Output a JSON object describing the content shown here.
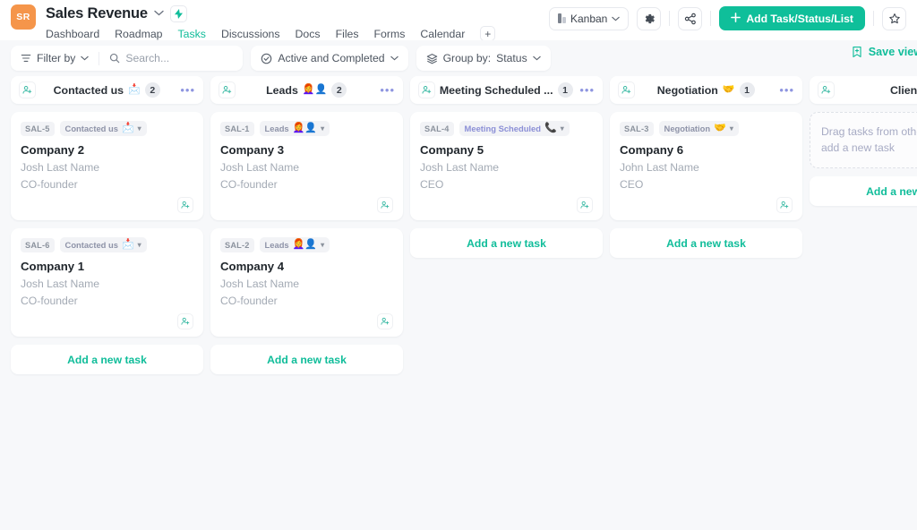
{
  "header": {
    "workspace_initials": "SR",
    "project_title": "Sales Revenue",
    "bolt_icon": "lightning-bolt-icon",
    "nav": [
      {
        "label": "Dashboard",
        "active": false
      },
      {
        "label": "Roadmap",
        "active": false
      },
      {
        "label": "Tasks",
        "active": true
      },
      {
        "label": "Discussions",
        "active": false
      },
      {
        "label": "Docs",
        "active": false
      },
      {
        "label": "Files",
        "active": false
      },
      {
        "label": "Forms",
        "active": false
      },
      {
        "label": "Calendar",
        "active": false
      }
    ],
    "add_tab_label": "+",
    "view_selector": "Kanban",
    "settings_icon": "gear-icon",
    "share_icon": "share-icon",
    "add_button": "Add Task/Status/List",
    "favorite_icon": "star-icon"
  },
  "toolbar": {
    "filter_label": "Filter by",
    "search_placeholder": "Search...",
    "status_filter": "Active and Completed",
    "group_by_label": "Group by:",
    "group_by_value": "Status",
    "save_view_label": "Save view"
  },
  "colors": {
    "accent": "#0fbf9a",
    "avatar_orange": "#f5954a",
    "status_contacted": "#8e93a8",
    "status_leads": "#8e93a8",
    "status_meeting": "#8b8fd6",
    "status_negotiation": "#8e93a8"
  },
  "board": {
    "columns": [
      {
        "title": "Contacted us",
        "emoji": "📩",
        "count": "2",
        "add_person_icon": "add-person-icon",
        "menu_icon": "more-options-icon",
        "add_task_label": "Add a new task",
        "cards": [
          {
            "id": "SAL-5",
            "status": "Contacted us",
            "status_emoji": "📩",
            "title": "Company 2",
            "person": "Josh Last Name",
            "role": "CO-founder"
          },
          {
            "id": "SAL-6",
            "status": "Contacted us",
            "status_emoji": "📩",
            "title": "Company 1",
            "person": "Josh Last Name",
            "role": "CO-founder"
          }
        ]
      },
      {
        "title": "Leads",
        "emoji": "👩‍🦰👤",
        "count": "2",
        "add_person_icon": "add-person-icon",
        "menu_icon": "more-options-icon",
        "add_task_label": "Add a new task",
        "cards": [
          {
            "id": "SAL-1",
            "status": "Leads",
            "status_emoji": "👩‍🦰👤",
            "title": "Company 3",
            "person": "Josh Last Name",
            "role": "CO-founder"
          },
          {
            "id": "SAL-2",
            "status": "Leads",
            "status_emoji": "👩‍🦰👤",
            "title": "Company 4",
            "person": "Josh Last Name",
            "role": "CO-founder"
          }
        ]
      },
      {
        "title": "Meeting Scheduled ...",
        "emoji": "",
        "count": "1",
        "add_person_icon": "add-person-icon",
        "menu_icon": "more-options-icon",
        "add_task_label": "Add a new task",
        "cards": [
          {
            "id": "SAL-4",
            "status": "Meeting Scheduled",
            "status_emoji": "📞",
            "title": "Company 5",
            "person": "Josh Last Name",
            "role": "CEO"
          }
        ]
      },
      {
        "title": "Negotiation",
        "emoji": "🤝",
        "count": "1",
        "add_person_icon": "add-person-icon",
        "menu_icon": "more-options-icon",
        "add_task_label": "Add a new task",
        "cards": [
          {
            "id": "SAL-3",
            "status": "Negotiation",
            "status_emoji": "🤝",
            "title": "Company 6",
            "person": "John Last Name",
            "role": "CEO"
          }
        ]
      },
      {
        "title": "Client",
        "emoji": "",
        "count": "",
        "add_person_icon": "add-person-icon",
        "menu_icon": "more-options-icon",
        "empty_text": "Drag tasks from other statuses or add a new task",
        "add_task_label": "Add a new task",
        "cards": []
      }
    ]
  }
}
